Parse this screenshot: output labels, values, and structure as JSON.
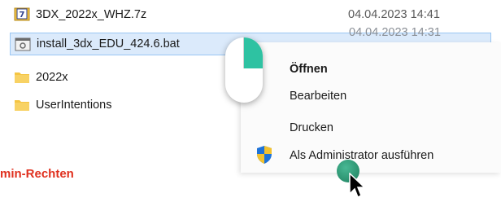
{
  "files": [
    {
      "name": "3DX_2022x_WHZ.7z",
      "date": "04.04.2023 14:41",
      "icon": "archive-icon"
    },
    {
      "name": "install_3dx_EDU_424.6.bat",
      "date": "04.04.2023 14:31",
      "icon": "batch-file-icon"
    },
    {
      "name": "2022x",
      "date": "",
      "icon": "folder-icon"
    },
    {
      "name": "UserIntentions",
      "date": "",
      "icon": "folder-icon"
    }
  ],
  "context_menu": {
    "items": [
      {
        "label": "Öffnen"
      },
      {
        "label": "Bearbeiten"
      },
      {
        "label": "Drucken"
      },
      {
        "label": "Als Administrator ausführen",
        "icon": "shield-icon"
      }
    ]
  },
  "overlay": {
    "text": "min-Rechten"
  },
  "colors": {
    "accent": "#2ec2a2",
    "selection": "#dbeafb",
    "overlay_text": "#e0301e"
  }
}
